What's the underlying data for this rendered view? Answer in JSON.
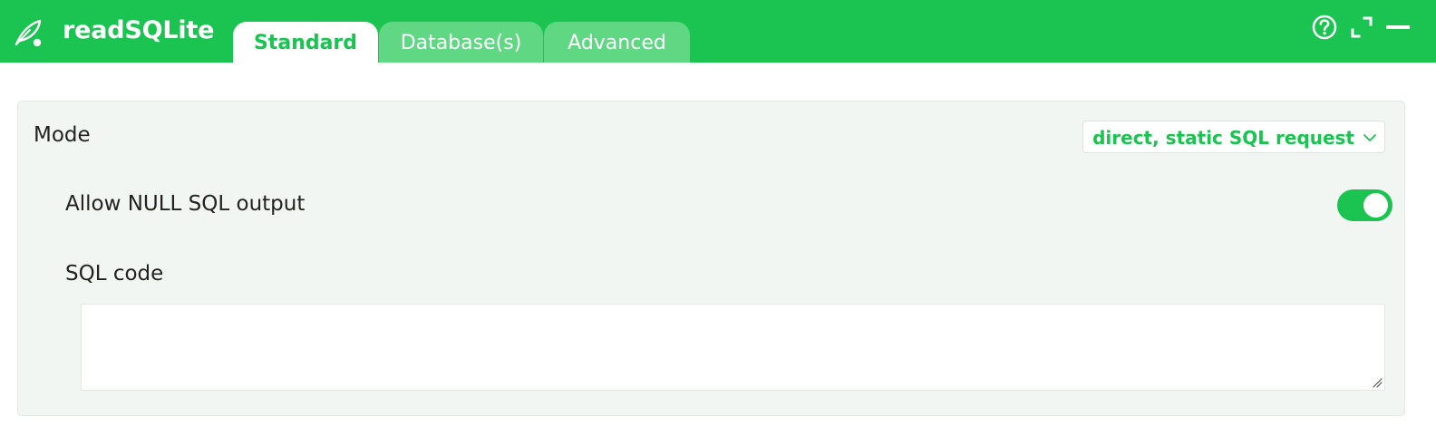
{
  "app": {
    "title": "readSQLite",
    "brand_color": "#1bc350"
  },
  "header": {
    "logo_icon": "feather-icon",
    "tabs": [
      {
        "label": "Standard",
        "active": true
      },
      {
        "label": "Database(s)",
        "active": false
      },
      {
        "label": "Advanced",
        "active": false
      }
    ],
    "actions": [
      {
        "icon": "help-circle-icon"
      },
      {
        "icon": "expand-icon"
      },
      {
        "icon": "minimize-icon"
      }
    ]
  },
  "form": {
    "mode": {
      "label": "Mode",
      "selected": "direct, static SQL request",
      "icon": "chevron-down-icon"
    },
    "allow_null": {
      "label": "Allow NULL SQL output",
      "enabled": true
    },
    "sql_code": {
      "label": "SQL code",
      "value": ""
    }
  }
}
